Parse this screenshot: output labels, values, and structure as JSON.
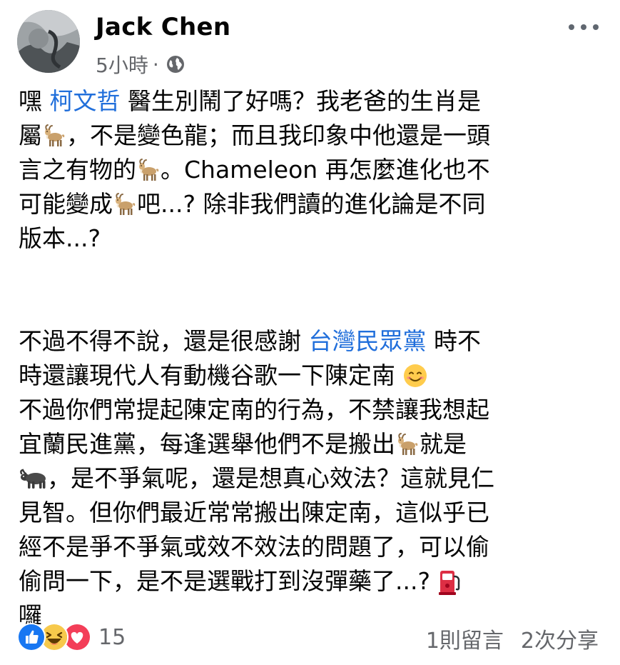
{
  "post": {
    "author": "Jack Chen",
    "time": "5小時",
    "separator": "·",
    "privacy_icon": "globe-icon",
    "more_icon": "more-options-icon"
  },
  "content": {
    "p1": {
      "l1_a": "嘿 ",
      "l1_mention": "柯文哲",
      "l1_b": " 醫生別鬧了好嗎？我老爸的生肖是",
      "l2_a": "屬",
      "l2_b": "，不是變色龍；而且我印象中他還是一頭",
      "l3_a": "言之有物的",
      "l3_b": "。Chameleon 再怎麼進化也不",
      "l4_a": "可能變成",
      "l4_b": "吧...? 除非我們讀的進化論是不同",
      "l5": "版本...?"
    },
    "p2": {
      "l1_a": "不過不得不說，還是很感謝 ",
      "l1_mention": "台灣民眾黨",
      "l1_b": " 時不",
      "l2": "時還讓現代人有動機谷歌一下陳定南 ",
      "l3": "不過你們常提起陳定南的行為，不禁讓我想起",
      "l4_a": "宜蘭民進黨，每逢選舉他們不是搬出",
      "l4_b": "就是",
      "l5": "，是不爭氣呢，還是想真心效法？這就見仁",
      "l6": "見智。但你們最近常常搬出陳定南，這似乎已",
      "l7": "經不是爭不爭氣或效不效法的問題了，可以偷",
      "l8": "偷問一下，是不是選戰打到沒彈藥了...?  ",
      "l9": "囉"
    },
    "emojis": {
      "goat": "goat-emoji",
      "ox": "water-buffalo-emoji",
      "smile": "smiling-face-emoji",
      "fuel": "fuel-pump-emoji"
    }
  },
  "footer": {
    "reaction_count": "15",
    "reaction_icons": [
      "like-icon",
      "haha-icon",
      "love-icon"
    ],
    "comments": "1則留言",
    "shares": "2次分享"
  },
  "colors": {
    "mention": "#216fdb",
    "meta_text": "#65676b",
    "like_blue": "#1877f2",
    "love_red": "#f33e58",
    "haha_yellow": "#f7c94b"
  }
}
